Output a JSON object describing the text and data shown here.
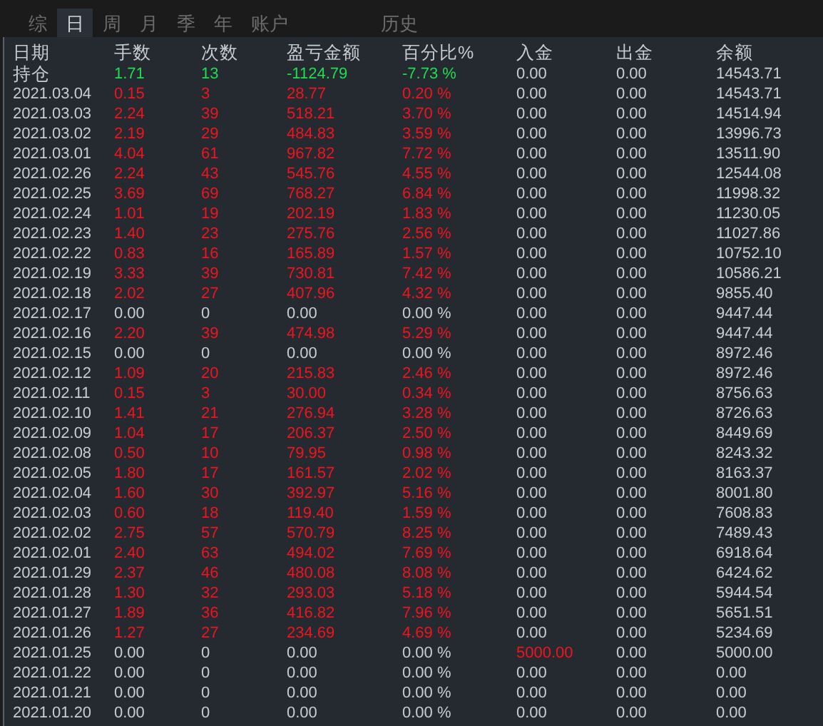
{
  "tabs": [
    {
      "label": "综",
      "selected": false
    },
    {
      "label": "日",
      "selected": true
    },
    {
      "label": "周",
      "selected": false
    },
    {
      "label": "月",
      "selected": false
    },
    {
      "label": "季",
      "selected": false
    },
    {
      "label": "年",
      "selected": false
    },
    {
      "label": "账户",
      "selected": false
    },
    {
      "label": "历史",
      "selected": false,
      "separated": true
    }
  ],
  "table": {
    "columns": [
      "日期",
      "手数",
      "次数",
      "盈亏金额",
      "百分比%",
      "入金",
      "出金",
      "余额"
    ],
    "rows": [
      {
        "kind": "summary",
        "cells": [
          "持仓",
          "1.71",
          "13",
          "-1124.79",
          "-7.73 %",
          "0.00",
          "0.00",
          "14543.71"
        ]
      },
      {
        "kind": "gain",
        "cells": [
          "2021.03.04",
          "0.15",
          "3",
          "28.77",
          "0.20 %",
          "0.00",
          "0.00",
          "14543.71"
        ]
      },
      {
        "kind": "gain",
        "cells": [
          "2021.03.03",
          "2.24",
          "39",
          "518.21",
          "3.70 %",
          "0.00",
          "0.00",
          "14514.94"
        ]
      },
      {
        "kind": "gain",
        "cells": [
          "2021.03.02",
          "2.19",
          "29",
          "484.83",
          "3.59 %",
          "0.00",
          "0.00",
          "13996.73"
        ]
      },
      {
        "kind": "gain",
        "cells": [
          "2021.03.01",
          "4.04",
          "61",
          "967.82",
          "7.72 %",
          "0.00",
          "0.00",
          "13511.90"
        ]
      },
      {
        "kind": "gain",
        "cells": [
          "2021.02.26",
          "2.24",
          "43",
          "545.76",
          "4.55 %",
          "0.00",
          "0.00",
          "12544.08"
        ]
      },
      {
        "kind": "gain",
        "cells": [
          "2021.02.25",
          "3.69",
          "69",
          "768.27",
          "6.84 %",
          "0.00",
          "0.00",
          "11998.32"
        ]
      },
      {
        "kind": "gain",
        "cells": [
          "2021.02.24",
          "1.01",
          "19",
          "202.19",
          "1.83 %",
          "0.00",
          "0.00",
          "11230.05"
        ]
      },
      {
        "kind": "gain",
        "cells": [
          "2021.02.23",
          "1.40",
          "23",
          "275.76",
          "2.56 %",
          "0.00",
          "0.00",
          "11027.86"
        ]
      },
      {
        "kind": "gain",
        "cells": [
          "2021.02.22",
          "0.83",
          "16",
          "165.89",
          "1.57 %",
          "0.00",
          "0.00",
          "10752.10"
        ]
      },
      {
        "kind": "gain",
        "cells": [
          "2021.02.19",
          "3.33",
          "39",
          "730.81",
          "7.42 %",
          "0.00",
          "0.00",
          "10586.21"
        ]
      },
      {
        "kind": "gain",
        "cells": [
          "2021.02.18",
          "2.02",
          "27",
          "407.96",
          "4.32 %",
          "0.00",
          "0.00",
          "9855.40"
        ]
      },
      {
        "kind": "flat",
        "cells": [
          "2021.02.17",
          "0.00",
          "0",
          "0.00",
          "0.00 %",
          "0.00",
          "0.00",
          "9447.44"
        ]
      },
      {
        "kind": "gain",
        "cells": [
          "2021.02.16",
          "2.20",
          "39",
          "474.98",
          "5.29 %",
          "0.00",
          "0.00",
          "9447.44"
        ]
      },
      {
        "kind": "flat",
        "cells": [
          "2021.02.15",
          "0.00",
          "0",
          "0.00",
          "0.00 %",
          "0.00",
          "0.00",
          "8972.46"
        ]
      },
      {
        "kind": "gain",
        "cells": [
          "2021.02.12",
          "1.09",
          "20",
          "215.83",
          "2.46 %",
          "0.00",
          "0.00",
          "8972.46"
        ]
      },
      {
        "kind": "gain",
        "cells": [
          "2021.02.11",
          "0.15",
          "3",
          "30.00",
          "0.34 %",
          "0.00",
          "0.00",
          "8756.63"
        ]
      },
      {
        "kind": "gain",
        "cells": [
          "2021.02.10",
          "1.41",
          "21",
          "276.94",
          "3.28 %",
          "0.00",
          "0.00",
          "8726.63"
        ]
      },
      {
        "kind": "gain",
        "cells": [
          "2021.02.09",
          "1.04",
          "17",
          "206.37",
          "2.50 %",
          "0.00",
          "0.00",
          "8449.69"
        ]
      },
      {
        "kind": "gain",
        "cells": [
          "2021.02.08",
          "0.50",
          "10",
          "79.95",
          "0.98 %",
          "0.00",
          "0.00",
          "8243.32"
        ]
      },
      {
        "kind": "gain",
        "cells": [
          "2021.02.05",
          "1.80",
          "17",
          "161.57",
          "2.02 %",
          "0.00",
          "0.00",
          "8163.37"
        ]
      },
      {
        "kind": "gain",
        "cells": [
          "2021.02.04",
          "1.60",
          "30",
          "392.97",
          "5.16 %",
          "0.00",
          "0.00",
          "8001.80"
        ]
      },
      {
        "kind": "gain",
        "cells": [
          "2021.02.03",
          "0.60",
          "18",
          "119.40",
          "1.59 %",
          "0.00",
          "0.00",
          "7608.83"
        ]
      },
      {
        "kind": "gain",
        "cells": [
          "2021.02.02",
          "2.75",
          "57",
          "570.79",
          "8.25 %",
          "0.00",
          "0.00",
          "7489.43"
        ]
      },
      {
        "kind": "gain",
        "cells": [
          "2021.02.01",
          "2.40",
          "63",
          "494.02",
          "7.69 %",
          "0.00",
          "0.00",
          "6918.64"
        ]
      },
      {
        "kind": "gain",
        "cells": [
          "2021.01.29",
          "2.37",
          "46",
          "480.08",
          "8.08 %",
          "0.00",
          "0.00",
          "6424.62"
        ]
      },
      {
        "kind": "gain",
        "cells": [
          "2021.01.28",
          "1.30",
          "32",
          "293.03",
          "5.18 %",
          "0.00",
          "0.00",
          "5944.54"
        ]
      },
      {
        "kind": "gain",
        "cells": [
          "2021.01.27",
          "1.89",
          "36",
          "416.82",
          "7.96 %",
          "0.00",
          "0.00",
          "5651.51"
        ]
      },
      {
        "kind": "gain",
        "cells": [
          "2021.01.26",
          "1.27",
          "27",
          "234.69",
          "4.69 %",
          "0.00",
          "0.00",
          "5234.69"
        ]
      },
      {
        "kind": "deposit",
        "cells": [
          "2021.01.25",
          "0.00",
          "0",
          "0.00",
          "0.00 %",
          "5000.00",
          "0.00",
          "5000.00"
        ]
      },
      {
        "kind": "flat",
        "cells": [
          "2021.01.22",
          "0.00",
          "0",
          "0.00",
          "0.00 %",
          "0.00",
          "0.00",
          "0.00"
        ]
      },
      {
        "kind": "flat",
        "cells": [
          "2021.01.21",
          "0.00",
          "0",
          "0.00",
          "0.00 %",
          "0.00",
          "0.00",
          "0.00"
        ]
      },
      {
        "kind": "flat",
        "cells": [
          "2021.01.20",
          "0.00",
          "0",
          "0.00",
          "0.00 %",
          "0.00",
          "0.00",
          "0.00"
        ]
      }
    ]
  }
}
